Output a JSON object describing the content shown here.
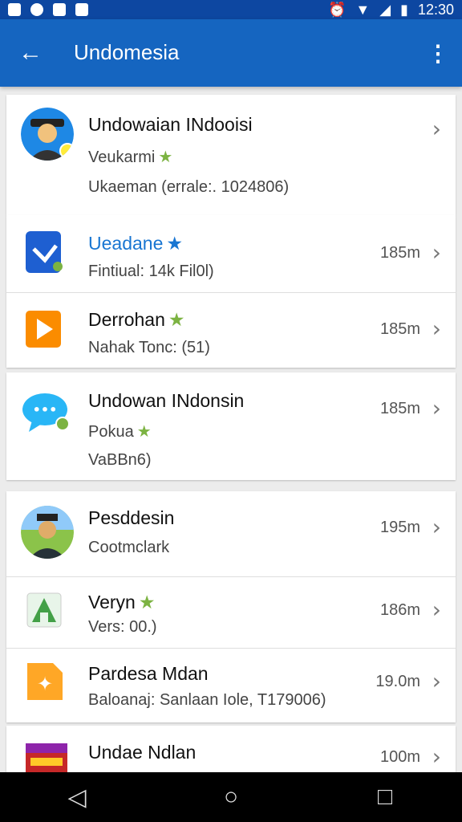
{
  "status": {
    "time": "12:30",
    "left_icons": [
      "image-icon",
      "record-icon",
      "sd-card-icon",
      "media-icon"
    ],
    "right_icons": [
      "alarm-icon",
      "wifi-icon",
      "signal-icon",
      "battery-icon"
    ]
  },
  "appbar": {
    "title": "Undomesia",
    "back_icon": "back-arrow-icon",
    "overflow_icon": "more-vert-icon"
  },
  "profile": {
    "name": "Undowaian INdooisi",
    "subtitle": "Veukarmi",
    "detail": "Ukaeman (errale:. 1024806)"
  },
  "groups": [
    {
      "items": [
        {
          "title": "Ueadane",
          "line1": "Fintiual: 14k Fil0l)",
          "size": "185m",
          "icon": "blue-doc-icon",
          "title_blue": true
        },
        {
          "title": "Derrohan",
          "line1": "Nahak Tonc: (51)",
          "size": "185m",
          "icon": "orange-play-icon"
        }
      ]
    },
    {
      "items": [
        {
          "title": "Undowan INdonsin",
          "line1": "Pokua",
          "line2": "VaBBn6)",
          "size": "185m",
          "icon": "chat-bubble-icon"
        }
      ]
    },
    {
      "items": [
        {
          "title": "Pesddesin",
          "line1": "Cootmclark",
          "size": "195m",
          "icon": "person-avatar-icon"
        },
        {
          "title": "Veryn",
          "line1": "Vers: 00.)",
          "size": "186m",
          "icon": "green-app-icon"
        },
        {
          "title": "Pardesa Mdan",
          "line1": "Baloanaj: Sanlaan Iole, T179006)",
          "size": "19.0m",
          "icon": "orange-star-icon"
        }
      ]
    },
    {
      "items": [
        {
          "title": "Undae Ndlan",
          "line1": "",
          "size": "100m",
          "icon": "store-icon"
        }
      ]
    }
  ],
  "navbar": {
    "back": "◁",
    "home": "○",
    "recents": "□"
  }
}
